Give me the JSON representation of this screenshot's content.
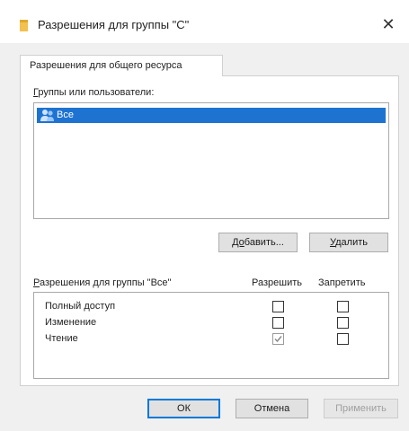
{
  "window": {
    "title": "Разрешения для группы \"C\"",
    "close_glyph": "✕"
  },
  "tab": {
    "label": "Разрешения для общего ресурса"
  },
  "users": {
    "label_underlined": "Г",
    "label_rest": "руппы или пользователи:",
    "items": [
      {
        "name": "Все",
        "icon": "users-group-icon",
        "selected": true
      }
    ]
  },
  "buttons": {
    "add_underlined": "До",
    "add_rest": "бавить...",
    "remove_underlined": "У",
    "remove_rest": "далить",
    "ok": "ОК",
    "cancel": "Отмена",
    "apply": "Применить"
  },
  "permissions": {
    "label_underlined": "Р",
    "label_rest": "азрешения для группы \"Все\"",
    "col_allow": "Разрешить",
    "col_deny": "Запретить",
    "rows": [
      {
        "name": "Полный доступ",
        "allow": false,
        "deny": false,
        "allow_disabled": false
      },
      {
        "name": "Изменение",
        "allow": false,
        "deny": false,
        "allow_disabled": false
      },
      {
        "name": "Чтение",
        "allow": true,
        "deny": false,
        "allow_disabled": true
      }
    ]
  },
  "colors": {
    "selection": "#1e73d1",
    "primary_border": "#0078d7",
    "folder_icon": "#f2c14e"
  }
}
